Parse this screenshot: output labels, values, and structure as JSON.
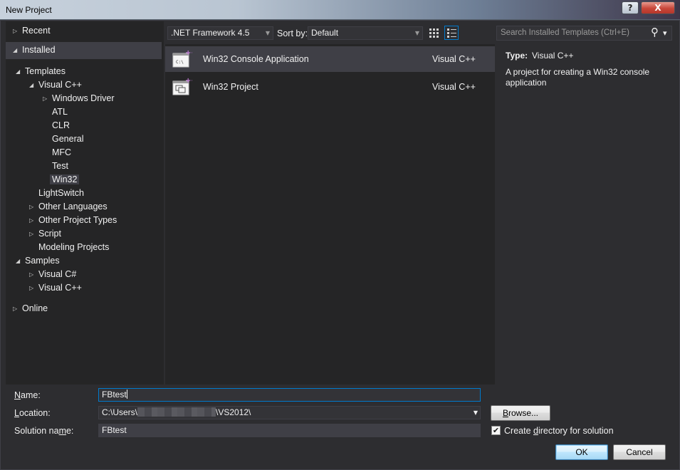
{
  "window": {
    "title": "New Project",
    "help_glyph": "?",
    "close_glyph": "X"
  },
  "tree": {
    "recent": "Recent",
    "installed": "Installed",
    "templates": "Templates",
    "visual_cpp": "Visual C++",
    "windows_driver": "Windows Driver",
    "atl": "ATL",
    "clr": "CLR",
    "general": "General",
    "mfc": "MFC",
    "test": "Test",
    "win32": "Win32",
    "lightswitch": "LightSwitch",
    "other_languages": "Other Languages",
    "other_project_types": "Other Project Types",
    "script": "Script",
    "modeling_projects": "Modeling Projects",
    "samples": "Samples",
    "samples_visual_cs": "Visual C#",
    "samples_visual_cpp": "Visual C++",
    "online": "Online",
    "collapsed_glyph": "▷",
    "expanded_glyph": "◢"
  },
  "toolbar": {
    "framework": ".NET Framework 4.5",
    "sort_label": "Sort by:",
    "sort_value": "Default",
    "dropdown_glyph": "▼",
    "search_placeholder": "Search Installed Templates (Ctrl+E)",
    "search_icon_glyph": "⚲",
    "search_dropdown_glyph": "▾"
  },
  "templates": [
    {
      "name": "Win32 Console Application",
      "language": "Visual C++",
      "icon_text": "C:\\"
    },
    {
      "name": "Win32 Project",
      "language": "Visual C++",
      "icon_text": ""
    }
  ],
  "detail": {
    "type_label": "Type:",
    "type_value": "Visual C++",
    "description": "A project for creating a Win32 console application"
  },
  "form": {
    "name_label_u": "N",
    "name_label_rest": "ame:",
    "name_value": "FBtest",
    "location_label_u": "L",
    "location_label_rest": "ocation:",
    "location_prefix": "C:\\Users\\",
    "location_suffix": "\\VS2012\\",
    "solution_label_pre": "Solution na",
    "solution_label_u": "m",
    "solution_label_post": "e:",
    "solution_value": "FBtest",
    "browse_label_u": "B",
    "browse_label_rest": "rowse...",
    "create_dir_pre": "Create ",
    "create_dir_u": "d",
    "create_dir_post": "irectory for solution",
    "create_dir_checked_glyph": "✔",
    "ok_label": "OK",
    "cancel_label": "Cancel"
  },
  "colors": {
    "accent": "#007acc",
    "background": "#2d2d30",
    "panel": "#252526",
    "selection": "#3f3f46"
  }
}
